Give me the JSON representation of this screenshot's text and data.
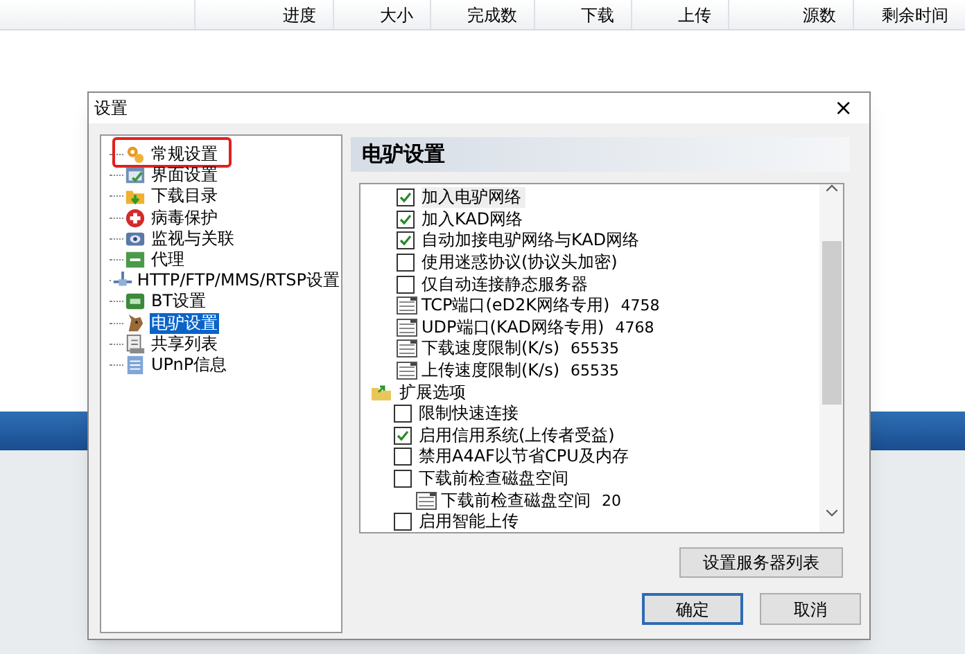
{
  "columns": [
    "进度",
    "大小",
    "完成数",
    "下载",
    "上传",
    "源数",
    "剩余时间"
  ],
  "dialog": {
    "title": "设置",
    "close": "×",
    "tree": [
      {
        "label": "常规设置",
        "selected": false,
        "annotated": true
      },
      {
        "label": "界面设置",
        "selected": false,
        "annotated": false
      },
      {
        "label": "下载目录",
        "selected": false,
        "annotated": false
      },
      {
        "label": "病毒保护",
        "selected": false,
        "annotated": false
      },
      {
        "label": "监视与关联",
        "selected": false,
        "annotated": false
      },
      {
        "label": "代理",
        "selected": false,
        "annotated": false
      },
      {
        "label": "HTTP/FTP/MMS/RTSP设置",
        "selected": false,
        "annotated": false
      },
      {
        "label": "BT设置",
        "selected": false,
        "annotated": false
      },
      {
        "label": "电驴设置",
        "selected": true,
        "annotated": false
      },
      {
        "label": "共享列表",
        "selected": false,
        "annotated": false
      },
      {
        "label": "UPnP信息",
        "selected": false,
        "annotated": false
      }
    ],
    "panel_title": "电驴设置",
    "options": [
      {
        "kind": "checkbox",
        "label": "加入电驴网络",
        "checked": true,
        "selected": true
      },
      {
        "kind": "checkbox",
        "label": "加入KAD网络",
        "checked": true,
        "selected": false
      },
      {
        "kind": "checkbox",
        "label": "自动加接电驴网络与KAD网络",
        "checked": true,
        "selected": false
      },
      {
        "kind": "checkbox",
        "label": "使用迷惑协议(协议头加密)",
        "checked": false,
        "selected": false
      },
      {
        "kind": "checkbox",
        "label": "仅自动连接静态服务器",
        "checked": false,
        "selected": false
      },
      {
        "kind": "field",
        "label": "TCP端口(eD2K网络专用)",
        "value": "4758"
      },
      {
        "kind": "field",
        "label": "UDP端口(KAD网络专用)",
        "value": "4768"
      },
      {
        "kind": "field",
        "label": "下载速度限制(K/s)",
        "value": "65535"
      },
      {
        "kind": "field",
        "label": "上传速度限制(K/s)",
        "value": "65535"
      },
      {
        "kind": "group",
        "label": "扩展选项",
        "children": [
          {
            "kind": "checkbox",
            "label": "限制快速连接",
            "checked": false,
            "selected": false
          },
          {
            "kind": "checkbox",
            "label": "启用信用系统(上传者受益)",
            "checked": true,
            "selected": false
          },
          {
            "kind": "checkbox",
            "label": "禁用A4AF以节省CPU及内存",
            "checked": false,
            "selected": false
          },
          {
            "kind": "checkbox",
            "label": "下载前检查磁盘空间",
            "checked": false,
            "selected": false,
            "children": [
              {
                "kind": "field",
                "label": "下载前检查磁盘空间",
                "value": "20"
              }
            ]
          },
          {
            "kind": "checkbox",
            "label": "启用智能上传",
            "checked": false,
            "selected": false
          }
        ]
      }
    ],
    "server_list_button": "设置服务器列表",
    "ok": "确定",
    "cancel": "取消"
  }
}
